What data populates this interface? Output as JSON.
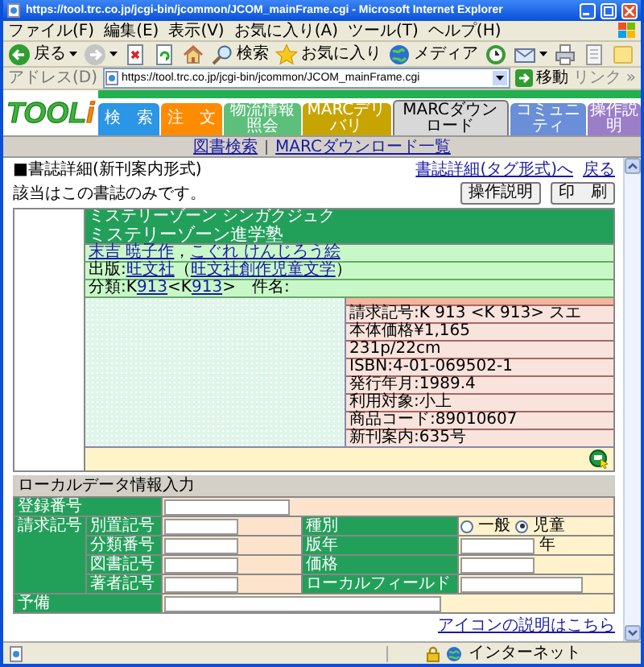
{
  "window": {
    "title": "https://tool.trc.co.jp/jcgi-bin/jcommon/JCOM_mainFrame.cgi - Microsoft Internet Explorer"
  },
  "menu": [
    "ファイル(F)",
    "編集(E)",
    "表示(V)",
    "お気に入り(A)",
    "ツール(T)",
    "ヘルプ(H)"
  ],
  "toolbar": [
    {
      "kind": "back",
      "label": "戻る",
      "dropdown": true
    },
    {
      "kind": "forward",
      "dropdown": true
    },
    {
      "kind": "stop",
      "dropdown": false
    },
    {
      "kind": "refresh",
      "dropdown": false
    },
    {
      "kind": "home",
      "dropdown": false
    },
    {
      "kind": "search",
      "label": "検索",
      "dropdown": false
    },
    {
      "kind": "favorites",
      "label": "お気に入り",
      "dropdown": false
    },
    {
      "kind": "media",
      "label": "メディア",
      "dropdown": false
    },
    {
      "kind": "history",
      "dropdown": false
    },
    {
      "kind": "mail",
      "dropdown": true
    },
    {
      "kind": "print",
      "dropdown": false
    },
    {
      "kind": "edit",
      "dropdown": false
    },
    {
      "kind": "note",
      "dropdown": false
    }
  ],
  "address_bar": {
    "label": "アドレス(D)",
    "value": "https://tool.trc.co.jp/jcgi-bin/jcommon/JCOM_mainFrame.cgi",
    "go": "移動",
    "links": "リンク",
    "more": "»"
  },
  "site": {
    "logo": {
      "text": "TOOL",
      "mark": "i"
    },
    "tabs": [
      {
        "label": "検　索",
        "color": "#2b95e6",
        "selected": false
      },
      {
        "label": "注　文",
        "color": "#ff8c00",
        "selected": false
      },
      {
        "label": "物流情報照会",
        "color": "#5cbf7a",
        "selected": false
      },
      {
        "label": "MARCデリバリ",
        "color": "#c8a400",
        "selected": false
      },
      {
        "label": "MARCダウンロード",
        "color": "#d8d8d8",
        "selected": true
      },
      {
        "label": "コミュニティ",
        "color": "#6a8fd8",
        "selected": false
      },
      {
        "label": "操作説明",
        "color": "#9a7ec8",
        "selected": false
      }
    ]
  },
  "subnav": [
    "図書検索",
    "MARCダウンロード一覧"
  ],
  "page": {
    "heading": "■書誌詳細(新刊案内形式)",
    "links": [
      "書誌詳細(タグ形式)へ",
      "戻る"
    ],
    "message": "該当はこの書誌のみです。",
    "buttons": [
      "操作説明",
      "印　刷"
    ]
  },
  "book": {
    "title_kana": "ミステリーゾーン シンガクジュク",
    "title": "ミステリーゾーン進学塾",
    "lines": [
      [
        {
          "text": "末吉 暁子作",
          "link": true
        },
        {
          "text": "，",
          "link": false
        },
        {
          "text": "こぐれ けんじろう絵",
          "link": true
        }
      ],
      [
        {
          "text": "出版:",
          "link": false
        },
        {
          "text": "旺文社",
          "link": true
        },
        {
          "text": "（",
          "link": false
        },
        {
          "text": "旺文社創作児童文学",
          "link": true
        },
        {
          "text": "）",
          "link": false
        }
      ],
      [
        {
          "text": "分類:K",
          "link": false
        },
        {
          "text": "913",
          "link": true
        },
        {
          "text": "<K",
          "link": false
        },
        {
          "text": "913",
          "link": true
        },
        {
          "text": ">　件名:",
          "link": false
        }
      ]
    ],
    "details": [
      "請求記号:K 913 <K 913> スエ",
      "本体価格¥1,165",
      "231p/22cm",
      "ISBN:4-01-069502-1",
      "発行年月:1989.4",
      "利用対象:小上",
      "商品コード:89010607",
      "新刊案内:635号"
    ]
  },
  "local_data": {
    "heading": "ローカルデータ情報入力",
    "registration": "登録番号",
    "call_number": "請求記号",
    "sub_fields": [
      "別置記号",
      "分類番号",
      "図書記号",
      "著者記号"
    ],
    "side_fields": [
      {
        "kind": "radio",
        "label": "種別",
        "options": [
          {
            "label": "一般",
            "selected": false
          },
          {
            "label": "児童",
            "selected": true
          }
        ]
      },
      {
        "kind": "field",
        "label": "版年",
        "suffix": "年"
      },
      {
        "kind": "field",
        "label": "価格"
      },
      {
        "kind": "long_field",
        "label": "ローカルフィールド"
      }
    ],
    "reserve": "予備"
  },
  "footer_link": "アイコンの説明はこちら",
  "status_bar": {
    "zone": "インターネット"
  }
}
